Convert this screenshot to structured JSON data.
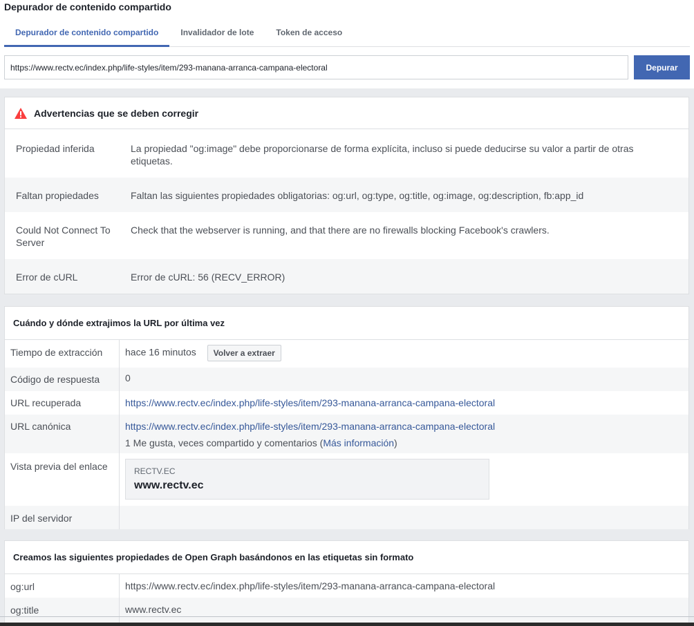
{
  "app": {
    "title": "Depurador de contenido compartido"
  },
  "tabs": [
    {
      "label": "Depurador de contenido compartido",
      "active": true
    },
    {
      "label": "Invalidador de lote",
      "active": false
    },
    {
      "label": "Token de acceso",
      "active": false
    }
  ],
  "search": {
    "url_value": "https://www.rectv.ec/index.php/life-styles/item/293-manana-arranca-campana-electoral",
    "button_label": "Depurar"
  },
  "colors": {
    "accent": "#4267b2",
    "link": "#365899",
    "warning": "#fa3e3e"
  },
  "warnings": {
    "icon": "warning-triangle-icon",
    "title": "Advertencias que se deben corregir",
    "rows": [
      {
        "label": "Propiedad inferida",
        "value": "La propiedad \"og:image\" debe proporcionarse de forma explícita, incluso si puede deducirse su valor a partir de otras etiquetas."
      },
      {
        "label": "Faltan propiedades",
        "value": "Faltan las siguientes propiedades obligatorias: og:url, og:type, og:title, og:image, og:description, fb:app_id"
      },
      {
        "label": "Could Not Connect To Server",
        "value": "Check that the webserver is running, and that there are no firewalls blocking Facebook's crawlers."
      },
      {
        "label": "Error de cURL",
        "value": "Error de cURL: 56 (RECV_ERROR)"
      }
    ]
  },
  "extraction": {
    "title": "Cuándo y dónde extrajimos la URL por última vez",
    "fetch_time_label": "Tiempo de extracción",
    "fetch_time_value": "hace 16 minutos",
    "refetch_button": "Volver a extraer",
    "response_code_label": "Código de respuesta",
    "response_code_value": "0",
    "fetched_url_label": "URL recuperada",
    "fetched_url_value": "https://www.rectv.ec/index.php/life-styles/item/293-manana-arranca-campana-electoral",
    "canonical_url_label": "URL canónica",
    "canonical_url_value": "https://www.rectv.ec/index.php/life-styles/item/293-manana-arranca-campana-electoral",
    "engagement_text": "1 Me gusta, veces compartido y comentarios (",
    "more_info_link": "Más información",
    "engagement_close": ")",
    "preview_label": "Vista previa del enlace",
    "preview_domain": "RECTV.EC",
    "preview_title": "www.rectv.ec",
    "server_ip_label": "IP del servidor",
    "server_ip_value": ""
  },
  "og": {
    "title": "Creamos las siguientes propiedades de Open Graph basándonos en las etiquetas sin formato",
    "rows": [
      {
        "label": "og:url",
        "value": "https://www.rectv.ec/index.php/life-styles/item/293-manana-arranca-campana-electoral"
      },
      {
        "label": "og:title",
        "value": "www.rectv.ec"
      }
    ]
  }
}
